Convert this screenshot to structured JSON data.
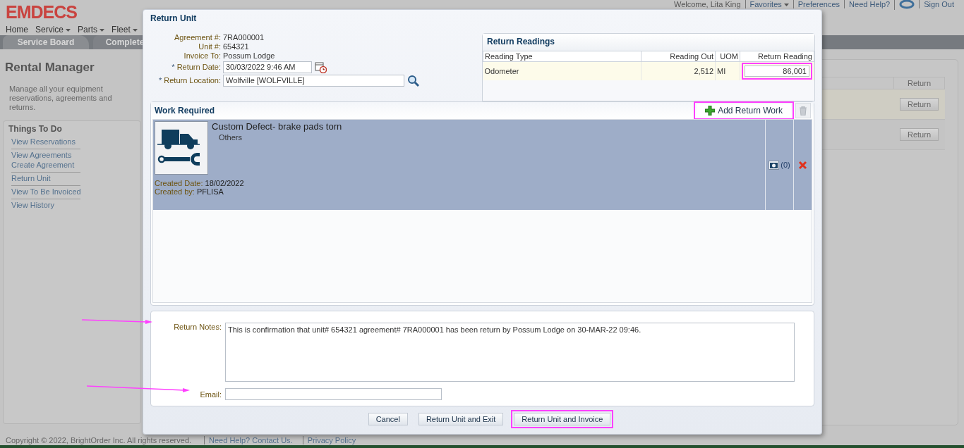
{
  "header": {
    "logo": "EMDECS",
    "nav": [
      {
        "label": "Home",
        "dropdown": false
      },
      {
        "label": "Service",
        "dropdown": true
      },
      {
        "label": "Parts",
        "dropdown": true
      },
      {
        "label": "Fleet",
        "dropdown": true
      }
    ],
    "user_links": [
      {
        "kind": "text",
        "label": "Welcome, Lita King",
        "dropdown": false
      },
      {
        "kind": "link",
        "label": "Favorites",
        "dropdown": true
      },
      {
        "kind": "link",
        "label": "Preferences",
        "dropdown": false
      },
      {
        "kind": "link",
        "label": "Need Help?",
        "dropdown": false
      },
      {
        "kind": "icon",
        "dropdown": false
      },
      {
        "kind": "link",
        "label": "Sign Out",
        "dropdown": false
      }
    ]
  },
  "tabs": [
    {
      "label": "Service Board",
      "selected": true
    },
    {
      "label": "Complete",
      "selected": false
    }
  ],
  "sidebar": {
    "title": "Rental Manager",
    "description": "Manage all your equipment reservations, agreements and returns.",
    "section": "Things To Do",
    "groups": [
      [
        "View Reservations"
      ],
      [
        "View Agreements",
        "Create Agreement"
      ],
      [
        "Return Unit"
      ],
      [
        "View To Be Invoiced"
      ],
      [
        "View History"
      ]
    ]
  },
  "background_table": {
    "column": "Return",
    "rows": [
      {
        "button": "Return"
      },
      {
        "button": "Return"
      }
    ]
  },
  "footer": {
    "copyright": "Copyright © 2022, BrightOrder Inc. All rights reserved.",
    "links": [
      "Need Help? Contact Us.",
      "Privacy Policy"
    ]
  },
  "dialog": {
    "title": "Return Unit",
    "fields": [
      {
        "kind": "text",
        "label": "Agreement #:",
        "value": "7RA000001"
      },
      {
        "kind": "text",
        "label": "Unit #:",
        "value": "654321"
      },
      {
        "kind": "text",
        "label": "Invoice To:",
        "value": "Possum Lodge"
      },
      {
        "kind": "date",
        "required_mark": "*",
        "label": "Return Date:",
        "value": "30/03/2022 9:46 AM"
      },
      {
        "kind": "search",
        "required_mark": "*",
        "label": "Return Location:",
        "value": "Wolfville [WOLFVILLE]"
      }
    ],
    "readings": {
      "title": "Return Readings",
      "columns": [
        "Reading Type",
        "Reading Out",
        "UOM",
        "Return Reading"
      ],
      "rows": [
        {
          "type": "Odometer",
          "reading_out": "2,512",
          "uom": "MI",
          "return_reading": "86,001",
          "highlighted": true
        }
      ]
    },
    "work": {
      "title": "Work Required",
      "add_button": {
        "label": "Add Return Work",
        "highlighted": true
      },
      "items": [
        {
          "title": "Custom Defect- brake pads torn",
          "category": "Others",
          "created_date_label": "Created Date:",
          "created_date": "18/02/2022",
          "created_by_label": "Created by:",
          "created_by": "PFLISA",
          "photo_count": "(0)",
          "selected": true
        }
      ]
    },
    "notes": {
      "label": "Return Notes:",
      "value": "This is confirmation that unit# 654321 agreement# 7RA000001 has been return by Possum Lodge on 30-MAR-22 09:46.",
      "arrow": true
    },
    "email": {
      "label": "Email:",
      "arrow": true
    },
    "buttons": [
      {
        "label": "Cancel",
        "highlighted": false
      },
      {
        "label": "Return Unit and Exit",
        "highlighted": false
      },
      {
        "label": "Return Unit and Invoice",
        "highlighted": true
      }
    ]
  }
}
